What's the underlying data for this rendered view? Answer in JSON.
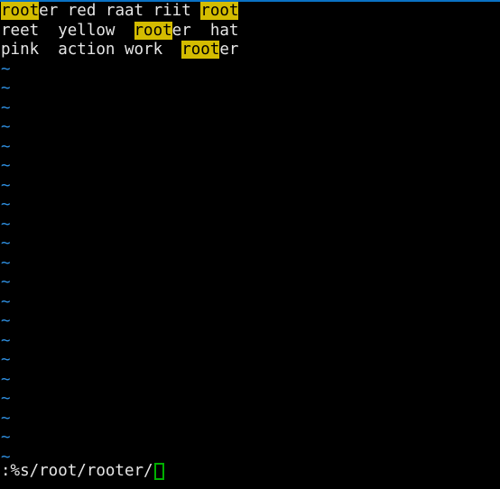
{
  "app": {
    "name": "vim",
    "mode": "command-line",
    "colors": {
      "background": "#000000",
      "foreground": "#e6e6e6",
      "top_rule": "#0a72c4",
      "tilde": "#2f8fe0",
      "search_highlight_bg": "#d4bc00",
      "search_highlight_fg": "#000000",
      "cursor_outline": "#00b000"
    }
  },
  "buffer": {
    "search_pattern": "root",
    "lines": [
      {
        "index": 1,
        "text": "rooter red raat riit root",
        "segments": [
          {
            "text": "root",
            "highlight": true
          },
          {
            "text": "er red raat riit ",
            "highlight": false
          },
          {
            "text": "root",
            "highlight": true
          }
        ]
      },
      {
        "index": 2,
        "text": "reet  yellow  rooter  hat",
        "segments": [
          {
            "text": "reet  yellow  ",
            "highlight": false
          },
          {
            "text": "root",
            "highlight": true
          },
          {
            "text": "er  hat",
            "highlight": false
          }
        ]
      },
      {
        "index": 3,
        "text": "pink  action work  rooter",
        "segments": [
          {
            "text": "pink  action work  ",
            "highlight": false
          },
          {
            "text": "root",
            "highlight": true
          },
          {
            "text": "er",
            "highlight": false
          }
        ]
      }
    ],
    "empty_line_marker": "~",
    "empty_line_count": 21
  },
  "cmdline": {
    "prompt": ":",
    "command": "%s/root/rooter/",
    "full_text": ":%s/root/rooter/",
    "cursor": "block-outline"
  }
}
